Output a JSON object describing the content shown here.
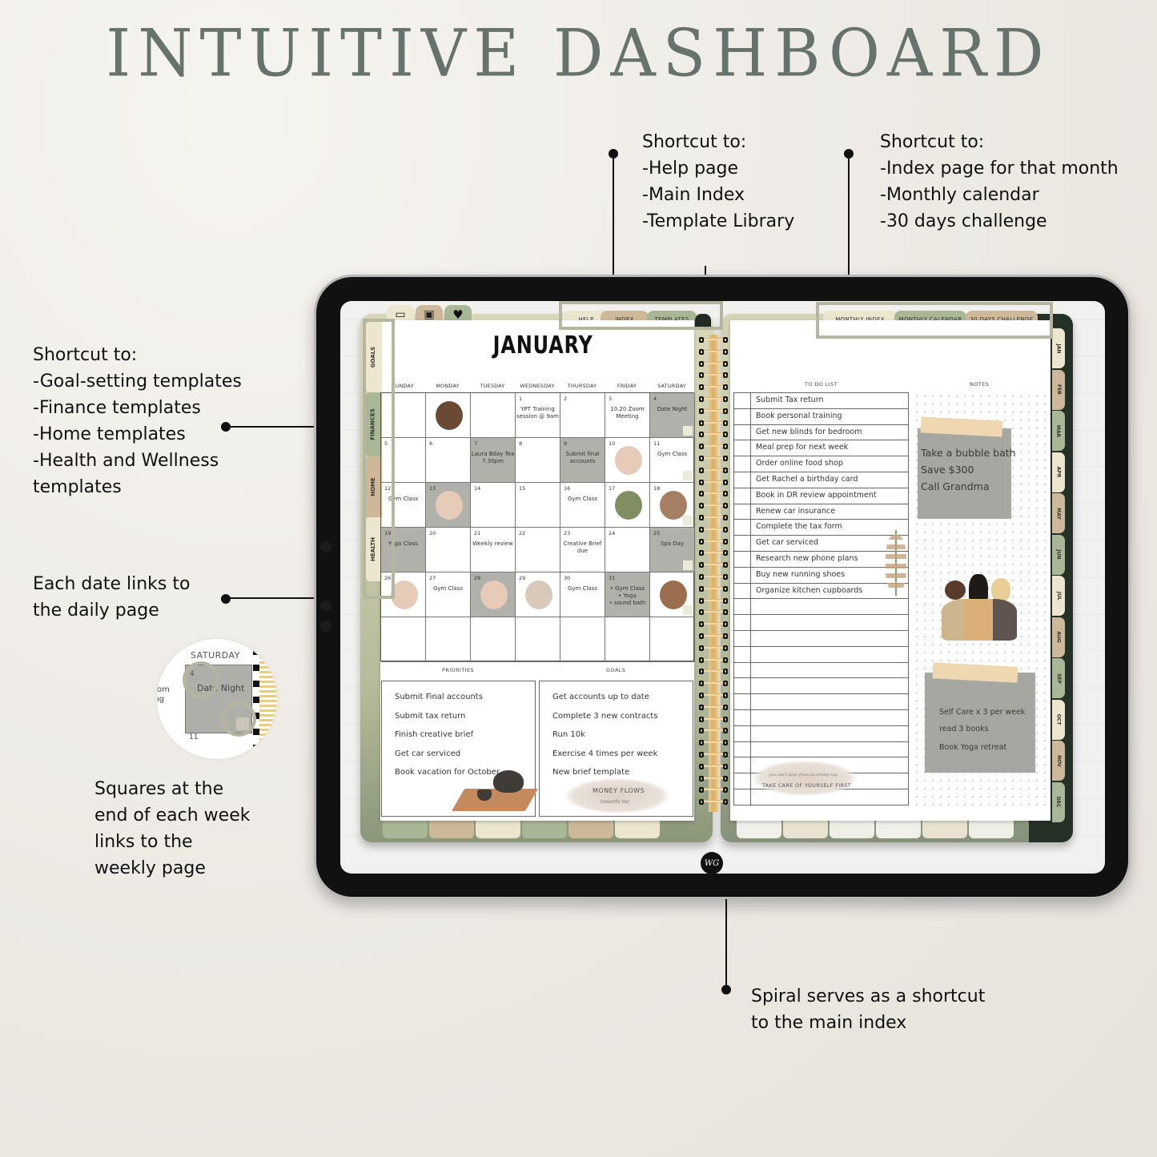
{
  "page": {
    "title": "INTUITIVE DASHBOARD"
  },
  "callouts": {
    "top_middle": {
      "lines": [
        "Shortcut to:",
        "-Help page",
        "-Main Index",
        "-Template Library"
      ]
    },
    "top_right": {
      "lines": [
        "Shortcut to:",
        "-Index page for that month",
        "-Monthly calendar",
        "-30 days challenge"
      ]
    },
    "left_tabs": {
      "lines": [
        "Shortcut to:",
        "-Goal-setting templates",
        "-Finance templates",
        "-Home templates",
        "-Health and Wellness",
        "templates"
      ]
    },
    "dates": {
      "lines": [
        "Each date links to",
        "the daily page"
      ]
    },
    "weekly": {
      "lines": [
        "Squares at the",
        "end of each week",
        "links to the",
        "weekly page"
      ]
    },
    "spiral": {
      "lines": [
        "Spiral serves as a shortcut",
        "to the main index"
      ]
    }
  },
  "zoom_inset": {
    "day_label": "SATURDAY",
    "date": "4",
    "event": "Date Night",
    "next_date": "11",
    "left_fragment_1": "om",
    "left_fragment_2": "ıg"
  },
  "planner": {
    "icon_tabs": [
      {
        "icon": "calendar-icon",
        "glyph": "▭",
        "color": "#ece6cf"
      },
      {
        "icon": "image-icon",
        "glyph": "▣",
        "color": "#cdb999"
      },
      {
        "icon": "heart-icon",
        "glyph": "♥",
        "color": "#a9b797"
      }
    ],
    "top_tabs_left": [
      {
        "label": "HELP",
        "color": "#ece6cf"
      },
      {
        "label": "INDEX",
        "color": "#cdb999"
      },
      {
        "label": "TEMPLATES",
        "color": "#a9b797"
      }
    ],
    "top_tabs_right": [
      {
        "label": "MONTHLY INDEX",
        "color": "#ece6cf"
      },
      {
        "label": "MONTHLY CALENDAR",
        "color": "#a9b797"
      },
      {
        "label": "30 DAYS CHALLENGE",
        "color": "#cdb999"
      }
    ],
    "side_tabs": [
      {
        "label": "GOALS",
        "color": "#ece6cf"
      },
      {
        "label": "FINANCES",
        "color": "#a9b797"
      },
      {
        "label": "HOME",
        "color": "#cdb999"
      },
      {
        "label": "HEALTH",
        "color": "#ece6cf"
      }
    ],
    "month_tabs": [
      {
        "label": "JAN",
        "color": "#ece6cf"
      },
      {
        "label": "FEB",
        "color": "#cdb999"
      },
      {
        "label": "MAR",
        "color": "#a9b797"
      },
      {
        "label": "APR",
        "color": "#ece6cf"
      },
      {
        "label": "MAY",
        "color": "#cdb999"
      },
      {
        "label": "JUN",
        "color": "#a9b797"
      },
      {
        "label": "JUL",
        "color": "#ece6cf"
      },
      {
        "label": "AUG",
        "color": "#cdb999"
      },
      {
        "label": "SEP",
        "color": "#a9b797"
      },
      {
        "label": "OCT",
        "color": "#ece6cf"
      },
      {
        "label": "NOV",
        "color": "#cdb999"
      },
      {
        "label": "DEC",
        "color": "#a9b797"
      }
    ],
    "calendar": {
      "month": "JANUARY",
      "weekdays": [
        "SUNDAY",
        "MONDAY",
        "TUESDAY",
        "WEDNESDAY",
        "THURSDAY",
        "FRIDAY",
        "SATURDAY"
      ],
      "weeks": [
        [
          {
            "d": "",
            "n": ""
          },
          {
            "d": "",
            "n": "",
            "img": "compact-illustration"
          },
          {
            "d": "",
            "n": ""
          },
          {
            "d": "1",
            "n": "YPT Training session @ 9am"
          },
          {
            "d": "2",
            "n": ""
          },
          {
            "d": "3",
            "n": "10.20 Zoom Meeting"
          },
          {
            "d": "4",
            "n": "Date Night",
            "gray": true
          }
        ],
        [
          {
            "d": "5",
            "n": ""
          },
          {
            "d": "6",
            "n": ""
          },
          {
            "d": "7",
            "n": "Laura Bday Tea 7.30pm",
            "gray": true
          },
          {
            "d": "8",
            "n": ""
          },
          {
            "d": "9",
            "n": "Submit final accounts",
            "gray": true
          },
          {
            "d": "10",
            "n": "",
            "img": "flower-illustration"
          },
          {
            "d": "11",
            "n": "Gym Class"
          }
        ],
        [
          {
            "d": "12",
            "n": "Gym Class"
          },
          {
            "d": "13",
            "n": "",
            "gray": true,
            "img": "flower-illustration"
          },
          {
            "d": "14",
            "n": ""
          },
          {
            "d": "15",
            "n": ""
          },
          {
            "d": "16",
            "n": "Gym Class"
          },
          {
            "d": "17",
            "n": "",
            "img": "plant-illustration"
          },
          {
            "d": "18",
            "n": "",
            "img": "coffee-illustration"
          }
        ],
        [
          {
            "d": "19",
            "n": "Yoga Class",
            "gray": true
          },
          {
            "d": "20",
            "n": ""
          },
          {
            "d": "21",
            "n": "Weekly review"
          },
          {
            "d": "22",
            "n": ""
          },
          {
            "d": "23",
            "n": "Creative Brief due"
          },
          {
            "d": "24",
            "n": ""
          },
          {
            "d": "25",
            "n": "Spa Day",
            "gray": true
          }
        ],
        [
          {
            "d": "26",
            "n": "",
            "img": "flower-illustration"
          },
          {
            "d": "27",
            "n": "Gym Class"
          },
          {
            "d": "28",
            "n": "",
            "gray": true,
            "img": "flower-illustration"
          },
          {
            "d": "29",
            "n": "",
            "img": "woman-illustration"
          },
          {
            "d": "30",
            "n": "Gym Class"
          },
          {
            "d": "31",
            "n": "• Gym Class\n• Yoga\n• sound bath",
            "gray": true
          },
          {
            "d": "",
            "n": "",
            "img": "bottle-illustration"
          }
        ],
        [
          {
            "d": "",
            "n": ""
          },
          {
            "d": "",
            "n": ""
          },
          {
            "d": "",
            "n": ""
          },
          {
            "d": "",
            "n": ""
          },
          {
            "d": "",
            "n": ""
          },
          {
            "d": "",
            "n": ""
          },
          {
            "d": "",
            "n": ""
          }
        ]
      ]
    },
    "priorities": {
      "label": "PRIORITIES",
      "items": [
        "Submit Final accounts",
        "Submit tax return",
        "Finish creative brief",
        "Get car serviced",
        "Book vacation for October"
      ]
    },
    "goals": {
      "label": "GOALS",
      "items": [
        "Get accounts up to date",
        "Complete 3 new contracts",
        "Run 10k",
        "Exercise 4 times per week",
        "New brief template"
      ],
      "quote_title": "MONEY FLOWS",
      "quote_sub": "towards me"
    },
    "todo": {
      "label": "TO DO LIST",
      "items": [
        "Submit Tax return",
        "Book personal training",
        "Get new blinds for bedroom",
        "Meal prep for next week",
        "Order online food shop",
        "Get Rachel a birthday card",
        "Book in DR review appointment",
        "Renew car insurance",
        "Complete the tax form",
        "Get car serviced",
        "Research new phone plans",
        "Buy new running shoes",
        "Organize kitchen cupboards"
      ],
      "quote_small": "you can't pour from an empty cup",
      "quote_main": "TAKE CARE OF YOURSELF FIRST"
    },
    "notes": {
      "label": "NOTES",
      "sticky_1": [
        "Take a bubble bath",
        "Save $300",
        "Call Grandma"
      ],
      "sticky_2": [
        "Self Care x 3 per week",
        "read 3 books",
        "Book Yoga retreat"
      ]
    },
    "logo": "WG"
  }
}
